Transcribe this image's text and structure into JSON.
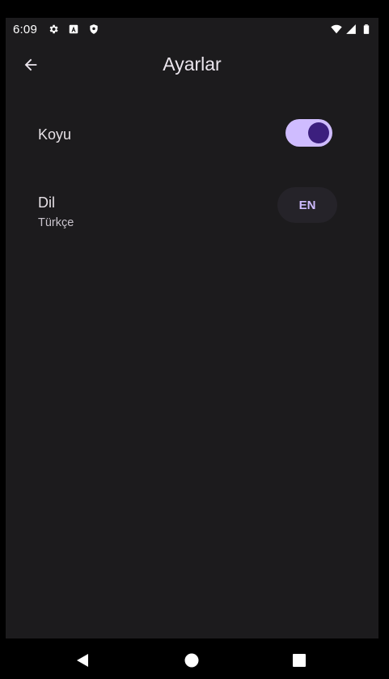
{
  "status_bar": {
    "time": "6:09",
    "icons_left": [
      "settings-icon",
      "font-icon",
      "shield-icon"
    ],
    "icons_right": [
      "wifi-icon",
      "signal-icon",
      "battery-icon"
    ]
  },
  "app_bar": {
    "back_icon": "arrow-back-icon",
    "title": "Ayarlar"
  },
  "settings": {
    "dark": {
      "label": "Koyu",
      "enabled": true
    },
    "language": {
      "label": "Dil",
      "value": "Türkçe",
      "button_label": "EN"
    }
  },
  "nav_bar": {
    "back": "nav-back-icon",
    "home": "nav-home-icon",
    "recents": "nav-recents-icon"
  },
  "colors": {
    "background": "#1c1b1d",
    "accent": "#cfbcff",
    "switch_thumb": "#3c1f7e",
    "chip_background": "#252329"
  }
}
